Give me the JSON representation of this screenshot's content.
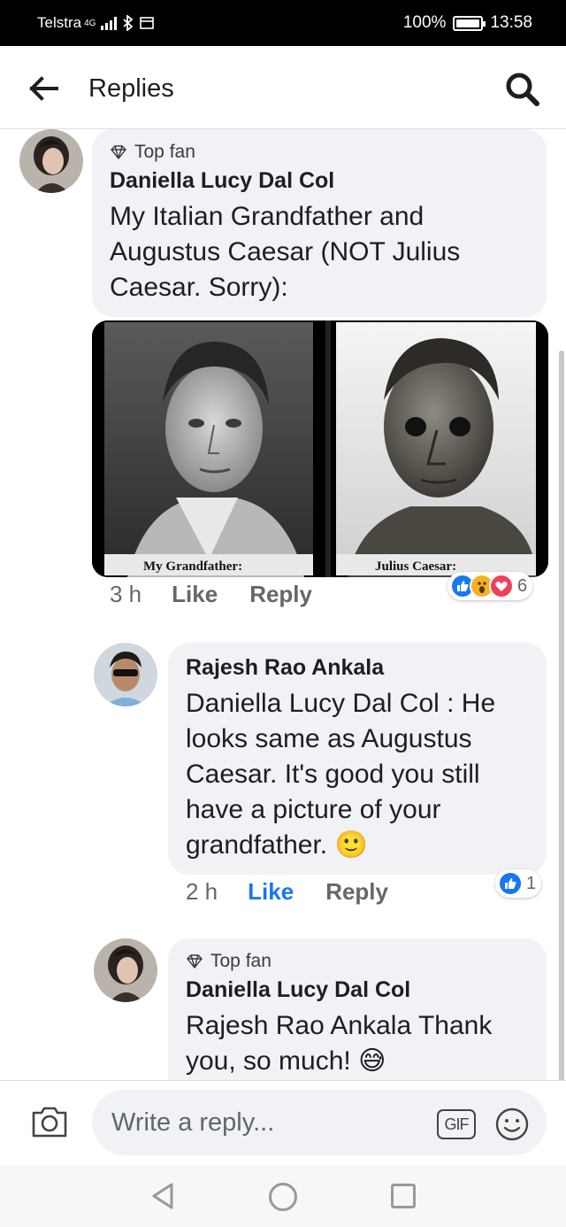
{
  "status_bar": {
    "carrier": "Telstra",
    "network": "4G",
    "battery": "100%",
    "time": "13:58"
  },
  "header": {
    "title": "Replies",
    "back_icon": "arrow-left-icon",
    "search_icon": "search-icon"
  },
  "comments": [
    {
      "badge": "Top fan",
      "author": "Daniella Lucy Dal Col",
      "text_lines": [
        "My Italian Grandfather and",
        "Augustus Caesar (NOT Julius",
        "Caesar. Sorry):"
      ],
      "photo_captions": [
        "My Grandfather:",
        "Julius Caesar:"
      ],
      "time": "3 h",
      "like": "Like",
      "reply": "Reply",
      "reactions": [
        "like",
        "wow",
        "love"
      ],
      "reaction_count": "6"
    },
    {
      "author": "Rajesh Rao Ankala",
      "text_lines": [
        "Daniella Lucy Dal Col : He",
        "looks same as Augustus",
        "Caesar. It's good you still",
        "have a picture of your",
        "grandfather. 🙂"
      ],
      "time": "2 h",
      "like": "Like",
      "reply": "Reply",
      "reactions": [
        "like"
      ],
      "reaction_count": "1"
    },
    {
      "badge": "Top fan",
      "author": "Daniella Lucy Dal Col",
      "text_lines": [
        "Rajesh Rao Ankala Thank",
        "you, so much! 😅"
      ]
    }
  ],
  "composer": {
    "placeholder": "Write a reply...",
    "gif": "GIF"
  },
  "colors": {
    "accent": "#1877f2",
    "love": "#f33e58",
    "wow": "#f7b125",
    "bubble": "#f0f2f5"
  }
}
